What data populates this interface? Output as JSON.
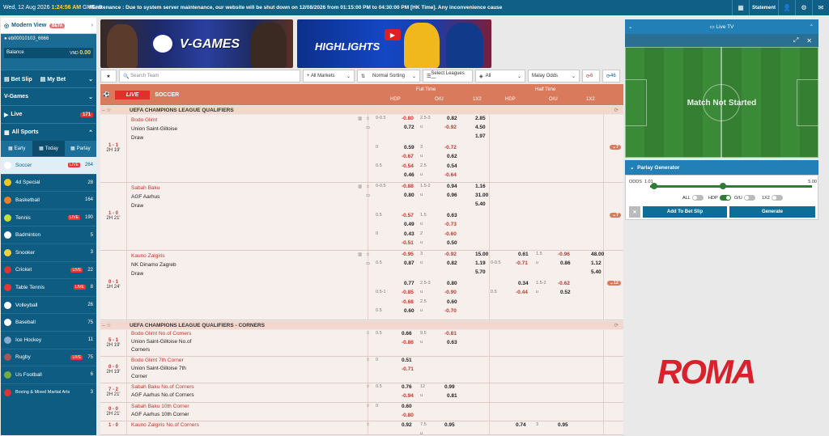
{
  "topbar": {
    "date": "Wed, 12 Aug 2026",
    "time": "1:24:56 AM",
    "tz": "GMT+8",
    "notice": "Maintenance : Due to system server maintenance, our website will be shut down on 12/08/2026 from 01:15:00 PM to 04:30:00 PM [HK Time]. Any inconvenience cause",
    "statement": "Statement"
  },
  "sidebar": {
    "modern_view": "Modern View",
    "beta": "BETA",
    "username": "eb00010103_6666",
    "balance_label": "Balance",
    "currency": "VND",
    "balance": "0.00",
    "bet_slip": "Bet Slip",
    "my_bet": "My Bet",
    "vgames": "V-Games",
    "live": "Live",
    "live_count": "171",
    "all_sports": "All Sports",
    "tabs": [
      "Early",
      "Today",
      "Parlay"
    ],
    "sports": [
      {
        "name": "Soccer",
        "live": "LIVE",
        "count": "264",
        "color": "#ffffff"
      },
      {
        "name": "4d Special",
        "live": "",
        "count": "28",
        "color": "#f5c518"
      },
      {
        "name": "Basketball",
        "live": "",
        "count": "164",
        "color": "#ef7d22"
      },
      {
        "name": "Tennis",
        "live": "LIVE",
        "count": "190",
        "color": "#c6e03a"
      },
      {
        "name": "Badminton",
        "live": "",
        "count": "5",
        "color": "#ffffff"
      },
      {
        "name": "Snooker",
        "live": "",
        "count": "3",
        "color": "#f0d040"
      },
      {
        "name": "Cricket",
        "live": "LIVE",
        "count": "22",
        "color": "#d33"
      },
      {
        "name": "Table Tennis",
        "live": "LIVE",
        "count": "8",
        "color": "#e33"
      },
      {
        "name": "Volleyball",
        "live": "",
        "count": "26",
        "color": "#ffffff"
      },
      {
        "name": "Baseball",
        "live": "",
        "count": "75",
        "color": "#ffffff"
      },
      {
        "name": "Ice Hockey",
        "live": "",
        "count": "11",
        "color": "#8ac"
      },
      {
        "name": "Rugby",
        "live": "LIVE",
        "count": "75",
        "color": "#a55"
      },
      {
        "name": "Us Football",
        "live": "",
        "count": "6",
        "color": "#7a4"
      },
      {
        "name": "Boxing & Mixed Martial Arts",
        "live": "",
        "count": "3",
        "color": "#d33"
      }
    ]
  },
  "banners": {
    "vgames": "V-GAMES",
    "highlights": "HIGHLIGHTS"
  },
  "filters": {
    "search_placeholder": "Search Team",
    "markets": "+ All Markets",
    "sorting": "Normal Sorting",
    "leagues": "Select Leagues —",
    "all": "All",
    "odds_type": "Malay Odds",
    "refresh_count": "6",
    "count46": "46"
  },
  "header": {
    "live": "LIVE",
    "sport": "SOCCER",
    "full_time": "Full Time",
    "half_time": "Half Time",
    "hdp": "HDP",
    "ou": "O/U",
    "x12": "1X2"
  },
  "groups": [
    {
      "name": "UEFA CHAMPIONS LEAGUE QUALIFIERS"
    },
    {
      "name": "UEFA CHAMPIONS LEAGUE QUALIFIERS - CORNERS"
    }
  ],
  "matches": [
    {
      "score": "1 - 1",
      "time": "2H 19'",
      "home": "Bodo Glimt",
      "away": "Union Saint-Gilloise",
      "draw": "Draw",
      "more": "7"
    },
    {
      "score": "1 - 0",
      "time": "2H 21'",
      "home": "Sabah Baku",
      "away": "AGF Aarhus",
      "draw": "Draw",
      "more": "7"
    },
    {
      "score": "0 - 1",
      "time": "1H 24'",
      "home": "Kauno Zalgiris",
      "away": "NK Dinamo Zagreb",
      "draw": "Draw",
      "more": "12"
    }
  ],
  "odds": {
    "m1": [
      [
        "0-0.5",
        "-0.80",
        "2.5-3",
        "0.82",
        "2.85"
      ],
      [
        "",
        "0.72",
        "u",
        "-0.92",
        "4.50"
      ],
      [
        "",
        "",
        "",
        "",
        "1.97"
      ],
      [
        "0",
        "0.59",
        "3",
        "-0.72",
        ""
      ],
      [
        "",
        "-0.67",
        "u",
        "0.62",
        ""
      ],
      [
        "0.5",
        "-0.54",
        "2.5",
        "0.54",
        ""
      ],
      [
        "",
        "0.46",
        "u",
        "-0.64",
        ""
      ]
    ],
    "m2": [
      [
        "0-0.5",
        "-0.88",
        "1.5-2",
        "0.94",
        "1.16"
      ],
      [
        "",
        "0.80",
        "u",
        "0.96",
        "31.00"
      ],
      [
        "",
        "",
        "",
        "",
        "5.40"
      ],
      [
        "0.5",
        "-0.57",
        "1.5",
        "0.63",
        ""
      ],
      [
        "",
        "0.49",
        "u",
        "-0.73",
        ""
      ],
      [
        "0",
        "0.43",
        "2",
        "-0.60",
        ""
      ],
      [
        "",
        "-0.51",
        "u",
        "0.50",
        ""
      ]
    ],
    "m3": [
      [
        "",
        "-0.95",
        "3",
        "-0.92",
        "15.00",
        "",
        "0.61",
        "1.5",
        "-0.96",
        "48.00"
      ],
      [
        "0.5",
        "0.87",
        "u",
        "0.82",
        "1.19",
        "0-0.5",
        "-0.71",
        "u",
        "0.86",
        "1.12"
      ],
      [
        "",
        "",
        "",
        "",
        "5.70",
        "",
        "",
        "",
        "",
        "5.40"
      ],
      [
        "",
        "0.77",
        "2.5-3",
        "0.80",
        "",
        "",
        "0.34",
        "1.5-2",
        "-0.62",
        ""
      ],
      [
        "0.5-1",
        "-0.85",
        "u",
        "-0.90",
        "",
        "0.5",
        "-0.44",
        "u",
        "0.52",
        ""
      ],
      [
        "",
        "-0.68",
        "2.5",
        "0.60",
        "",
        "",
        "",
        "",
        "",
        ""
      ],
      [
        "0.5",
        "0.60",
        "u",
        "-0.70",
        "",
        "",
        "",
        "",
        "",
        ""
      ]
    ]
  },
  "corners": [
    {
      "score": "5 - 1",
      "time": "2H 19'",
      "home": "Bodo Glimt No.of Corners",
      "away": "Union Saint-Gilloise No.of",
      "away2": "Corners",
      "hdp": "0.5",
      "h1": "0.66",
      "h2": "-0.86",
      "ou": "9.5",
      "o1": "-0.81",
      "o2": "0.63"
    },
    {
      "score": "0 - 0",
      "time": "2H 19'",
      "home": "Bodo Glimt 7th Corner",
      "away": "Union Saint-Gilloise 7th",
      "away2": "Corner",
      "hdp": "0",
      "h1": "0.51",
      "h2": "-0.71",
      "ou": "",
      "o1": "",
      "o2": ""
    },
    {
      "score": "7 - 2",
      "time": "2H 21'",
      "home": "Sabah Baku No.of Corners",
      "away": "AGF Aarhus No.of Corners",
      "away2": "",
      "hdp": "0.5",
      "h1": "0.76",
      "h2": "-0.94",
      "ou": "12",
      "o1": "0.99",
      "o2": "0.81"
    },
    {
      "score": "0 - 0",
      "time": "2H 21'",
      "home": "Sabah Baku 10th Corner",
      "away": "AGF Aarhus 10th Corner",
      "away2": "",
      "hdp": "0",
      "h1": "0.60",
      "h2": "-0.80",
      "ou": "",
      "o1": "",
      "o2": ""
    },
    {
      "score": "1 - 0",
      "time": "",
      "home": "Kauno Zalgiris No.of Corners",
      "away": "",
      "away2": "",
      "hdp": "",
      "h1": "0.92",
      "h2": "",
      "ou": "7.5",
      "o1": "0.95",
      "o2": "",
      "h1b": "0.74",
      "oub": "3",
      "o1b": "0.95"
    }
  ],
  "tv": {
    "title": "Live TV",
    "status": "Match Not Started"
  },
  "parlay": {
    "title": "Parlay Generator",
    "odds_label": "ODDS",
    "min": "1.01",
    "max": "5.00",
    "toggles": [
      "ALL",
      "HDP",
      "O/U",
      "1X2"
    ],
    "add": "Add To Bet Slip",
    "generate": "Generate"
  },
  "watermark": "ROMA"
}
